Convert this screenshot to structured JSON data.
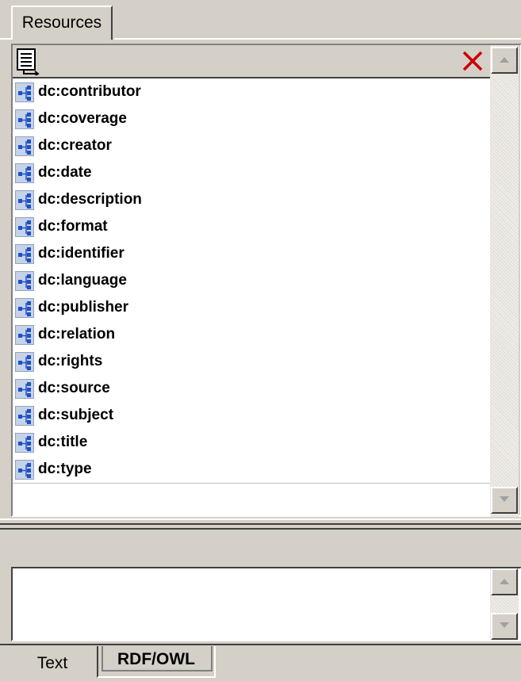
{
  "top_tab": {
    "label": "Resources"
  },
  "toolbar": {
    "list_icon": "list-view-icon",
    "delete_icon": "delete-x-icon",
    "delete_color": "#cc0000"
  },
  "resources": [
    {
      "label": "dc:contributor",
      "icon": "property-node-icon"
    },
    {
      "label": "dc:coverage",
      "icon": "property-node-icon"
    },
    {
      "label": "dc:creator",
      "icon": "property-node-icon"
    },
    {
      "label": "dc:date",
      "icon": "property-node-icon"
    },
    {
      "label": "dc:description",
      "icon": "property-node-icon"
    },
    {
      "label": "dc:format",
      "icon": "property-node-icon"
    },
    {
      "label": "dc:identifier",
      "icon": "property-node-icon"
    },
    {
      "label": "dc:language",
      "icon": "property-node-icon"
    },
    {
      "label": "dc:publisher",
      "icon": "property-node-icon"
    },
    {
      "label": "dc:relation",
      "icon": "property-node-icon"
    },
    {
      "label": "dc:rights",
      "icon": "property-node-icon"
    },
    {
      "label": "dc:source",
      "icon": "property-node-icon"
    },
    {
      "label": "dc:subject",
      "icon": "property-node-icon"
    },
    {
      "label": "dc:title",
      "icon": "property-node-icon"
    },
    {
      "label": "dc:type",
      "icon": "property-node-icon"
    }
  ],
  "bottom_tabs": [
    {
      "label": "Text",
      "active": false
    },
    {
      "label": "RDF/OWL",
      "active": true
    }
  ],
  "colors": {
    "chrome": "#d4d0c8",
    "icon_fill": "#c6d2e6",
    "icon_node": "#1e50c8"
  }
}
